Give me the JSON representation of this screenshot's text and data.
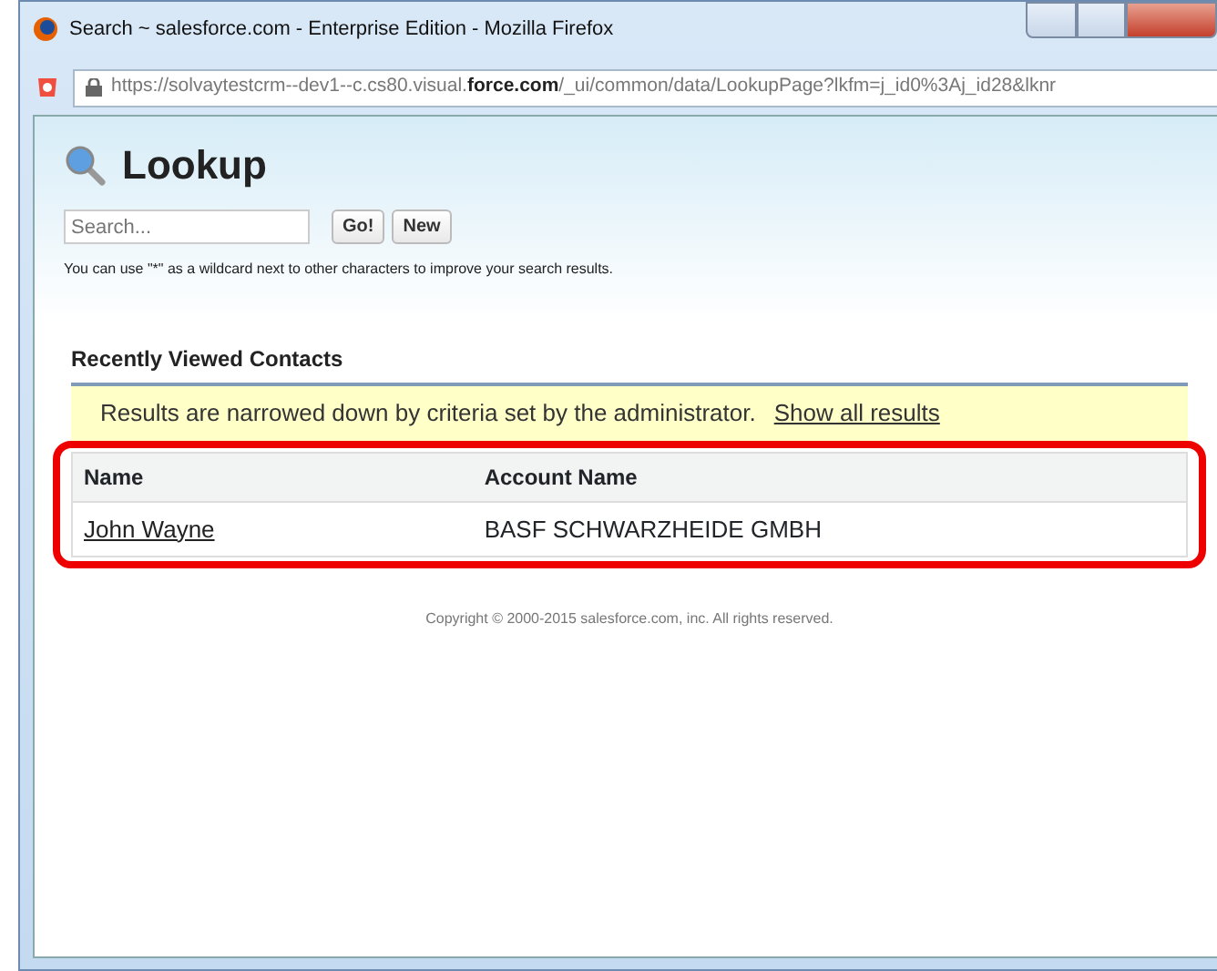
{
  "window": {
    "title": "Search ~ salesforce.com - Enterprise Edition - Mozilla Firefox",
    "url_prefix": "https://solvaytestcrm--dev1--c.cs80.visual.",
    "url_domain": "force.com",
    "url_rest": "/_ui/common/data/LookupPage?lkfm=j_id0%3Aj_id28&lknr"
  },
  "page": {
    "title": "Lookup",
    "search": {
      "placeholder": "Search..."
    },
    "buttons": [
      "Go!",
      "New"
    ],
    "hint": "You can use \"*\" as a wildcard next to other characters to improve your search results.",
    "section_title": "Recently Viewed Contacts",
    "notice": "Results are narrowed down by criteria set by the administrator.",
    "notice_link": "Show all results",
    "table": {
      "highlighted": true,
      "columns": [
        "Name",
        "Account Name"
      ],
      "rows": [
        {
          "name": "John Wayne",
          "account": "BASF SCHWARZHEIDE GMBH"
        }
      ]
    },
    "footer": "Copyright © 2000-2015 salesforce.com, inc. All rights reserved."
  }
}
